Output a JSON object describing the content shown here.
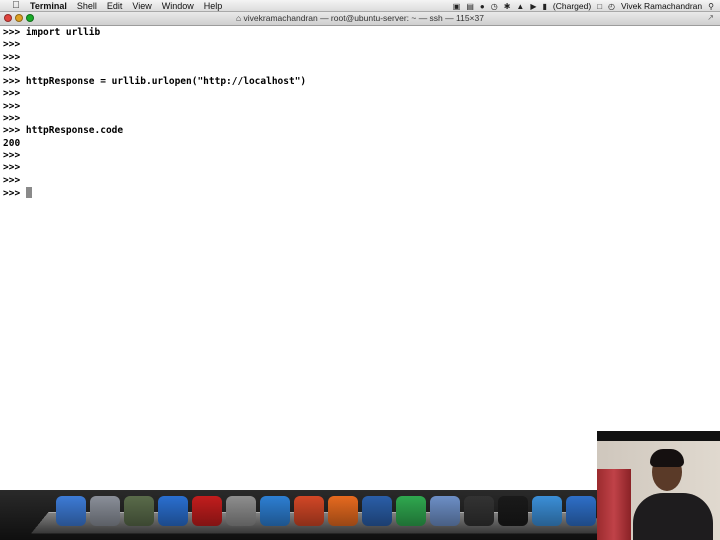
{
  "menubar": {
    "app_name": "Terminal",
    "menus": [
      "Shell",
      "Edit",
      "View",
      "Window",
      "Help"
    ],
    "battery_status": "(Charged)",
    "user_name": "Vivek Ramachandran"
  },
  "window": {
    "title": "vivekramachandran — root@ubuntu-server: ~ — ssh — 115×37"
  },
  "terminal": {
    "lines": [
      ">>> import urllib",
      ">>>",
      ">>>",
      ">>>",
      ">>> httpResponse = urllib.urlopen(\"http://localhost\")",
      ">>>",
      ">>>",
      ">>>",
      ">>> httpResponse.code",
      "200",
      ">>>",
      ">>>",
      ">>>"
    ],
    "prompt": ">>> "
  },
  "dock": {
    "items": [
      {
        "name": "finder-icon",
        "color": "#3d7bd6"
      },
      {
        "name": "launchpad-icon",
        "color": "#8a8f99"
      },
      {
        "name": "preview-icon",
        "color": "#5a6b4a"
      },
      {
        "name": "itunes-icon",
        "color": "#2a6fd0"
      },
      {
        "name": "photo-booth-icon",
        "color": "#c21d1d"
      },
      {
        "name": "system-preferences-icon",
        "color": "#8e8e8e"
      },
      {
        "name": "word-icon",
        "color": "#2d7fd3"
      },
      {
        "name": "powerpoint-icon",
        "color": "#d24726"
      },
      {
        "name": "firefox-icon",
        "color": "#e66a1f"
      },
      {
        "name": "virtualbox-icon",
        "color": "#2a5ea8"
      },
      {
        "name": "chrome-icon",
        "color": "#2fa84f"
      },
      {
        "name": "app-store-icon",
        "color": "#6d8fc6"
      },
      {
        "name": "display-icon",
        "color": "#333333"
      },
      {
        "name": "terminal-icon",
        "color": "#1a1a1a"
      },
      {
        "name": "safari-icon",
        "color": "#3b8fd8"
      },
      {
        "name": "quicktime-icon",
        "color": "#2e6fc8"
      }
    ]
  }
}
